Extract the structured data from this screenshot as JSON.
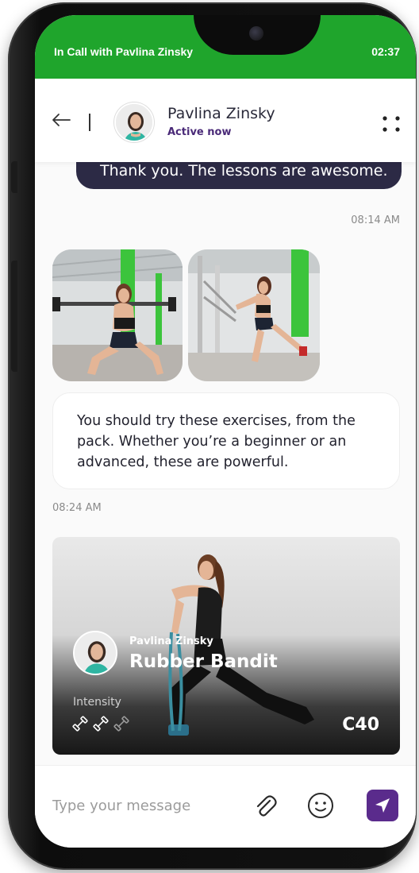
{
  "call_banner": {
    "label": "In Call with Pavlina Zinsky",
    "duration": "02:37",
    "color": "#1fa52c"
  },
  "header": {
    "contact_name": "Pavlina Zinsky",
    "status": "Active now",
    "status_color": "#4a2a78",
    "back_icon": "back-arrow-icon",
    "more_icon": "more-dots-icon"
  },
  "messages": {
    "sent": {
      "text": "Thank you. The lessons are awesome.",
      "time": "08:14 AM",
      "bubble_color": "#2c2a45"
    },
    "photos": [
      {
        "name": "squat-exercise-photo"
      },
      {
        "name": "cable-exercise-photo"
      }
    ],
    "received": {
      "text": "You should try these exercises, from the pack. Whether you’re a beginner or an advanced, these are powerful.",
      "time": "08:24 AM"
    }
  },
  "workout_card": {
    "author": "Pavlina Zinsky",
    "title": "Rubber Bandit",
    "intensity_label": "Intensity",
    "intensity_level": 2,
    "intensity_max": 3,
    "code": "C40"
  },
  "composer": {
    "placeholder": "Type your message",
    "value": "",
    "attach_icon": "paperclip-icon",
    "emoji_icon": "smiley-icon",
    "send_icon": "send-icon",
    "send_color": "#5a2b8c"
  }
}
